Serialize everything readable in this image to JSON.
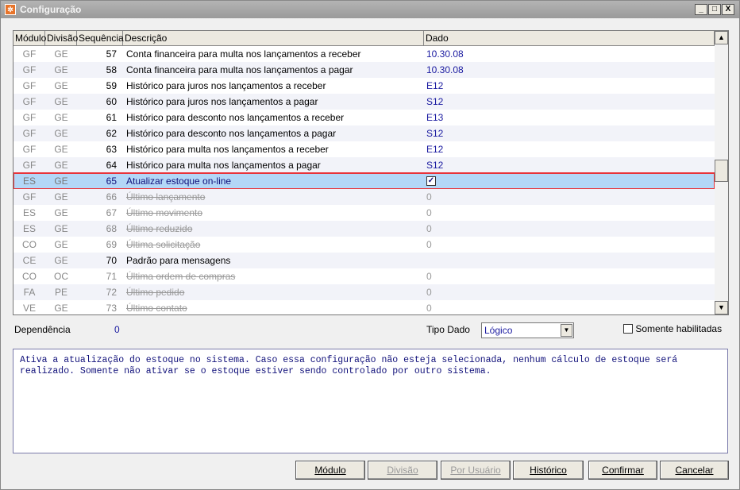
{
  "window": {
    "title": "Configuração",
    "controls": [
      "_",
      "□",
      "X"
    ]
  },
  "columns": [
    "Módulo",
    "Divisão",
    "Sequência",
    "Descrição",
    "Dado"
  ],
  "rows": [
    {
      "mod": "GF",
      "div": "GE",
      "seq": "57",
      "desc": "Conta financeira para multa nos lançamentos a receber",
      "dado": "10.30.08",
      "enabled": true
    },
    {
      "mod": "GF",
      "div": "GE",
      "seq": "58",
      "desc": "Conta financeira para multa nos lançamentos a pagar",
      "dado": "10.30.08",
      "enabled": true
    },
    {
      "mod": "GF",
      "div": "GE",
      "seq": "59",
      "desc": "Histórico para juros nos lançamentos a receber",
      "dado": "E12",
      "enabled": true
    },
    {
      "mod": "GF",
      "div": "GE",
      "seq": "60",
      "desc": "Histórico para juros nos lançamentos a pagar",
      "dado": "S12",
      "enabled": true
    },
    {
      "mod": "GF",
      "div": "GE",
      "seq": "61",
      "desc": "Histórico para desconto nos lançamentos a receber",
      "dado": "E13",
      "enabled": true
    },
    {
      "mod": "GF",
      "div": "GE",
      "seq": "62",
      "desc": "Histórico para desconto nos lançamentos a pagar",
      "dado": "S12",
      "enabled": true
    },
    {
      "mod": "GF",
      "div": "GE",
      "seq": "63",
      "desc": "Histórico para multa nos lançamentos a receber",
      "dado": "E12",
      "enabled": true
    },
    {
      "mod": "GF",
      "div": "GE",
      "seq": "64",
      "desc": "Histórico para multa nos lançamentos a pagar",
      "dado": "S12",
      "enabled": true
    },
    {
      "mod": "ES",
      "div": "GE",
      "seq": "65",
      "desc": "Atualizar estoque on-line",
      "dado": "",
      "checked": true,
      "enabled": true,
      "selected": true
    },
    {
      "mod": "GF",
      "div": "GE",
      "seq": "66",
      "desc": "Último lançamento",
      "dado": "0",
      "enabled": false
    },
    {
      "mod": "ES",
      "div": "GE",
      "seq": "67",
      "desc": "Último movimento",
      "dado": "0",
      "enabled": false
    },
    {
      "mod": "ES",
      "div": "GE",
      "seq": "68",
      "desc": "Último reduzido",
      "dado": "0",
      "enabled": false
    },
    {
      "mod": "CO",
      "div": "GE",
      "seq": "69",
      "desc": "Última solicitação",
      "dado": "0",
      "enabled": false
    },
    {
      "mod": "CE",
      "div": "GE",
      "seq": "70",
      "desc": "Padrão para mensagens",
      "dado": "",
      "enabled": true
    },
    {
      "mod": "CO",
      "div": "OC",
      "seq": "71",
      "desc": "Última ordem de compras",
      "dado": "0",
      "enabled": false
    },
    {
      "mod": "FA",
      "div": "PE",
      "seq": "72",
      "desc": "Último pedido",
      "dado": "0",
      "enabled": false
    },
    {
      "mod": "VE",
      "div": "GE",
      "seq": "73",
      "desc": "Último contato",
      "dado": "0",
      "enabled": false
    }
  ],
  "footer": {
    "dependencia_label": "Dependência",
    "dependencia_value": "0",
    "tipo_label": "Tipo Dado",
    "tipo_value": "Lógico",
    "somente_label": "Somente habilitadas"
  },
  "description": "Ativa a atualização do estoque no sistema. Caso essa configuração não esteja selecionada, nenhum cálculo de estoque será realizado. Somente não ativar se o estoque estiver sendo controlado por outro sistema.",
  "buttons": [
    {
      "label": "Módulo",
      "enabled": true
    },
    {
      "label": "Divisão",
      "enabled": false
    },
    {
      "label": "Por Usuário",
      "enabled": false
    },
    {
      "label": "Histórico",
      "enabled": true
    },
    {
      "label": "Confirmar",
      "enabled": true
    },
    {
      "label": "Cancelar",
      "enabled": true
    }
  ]
}
